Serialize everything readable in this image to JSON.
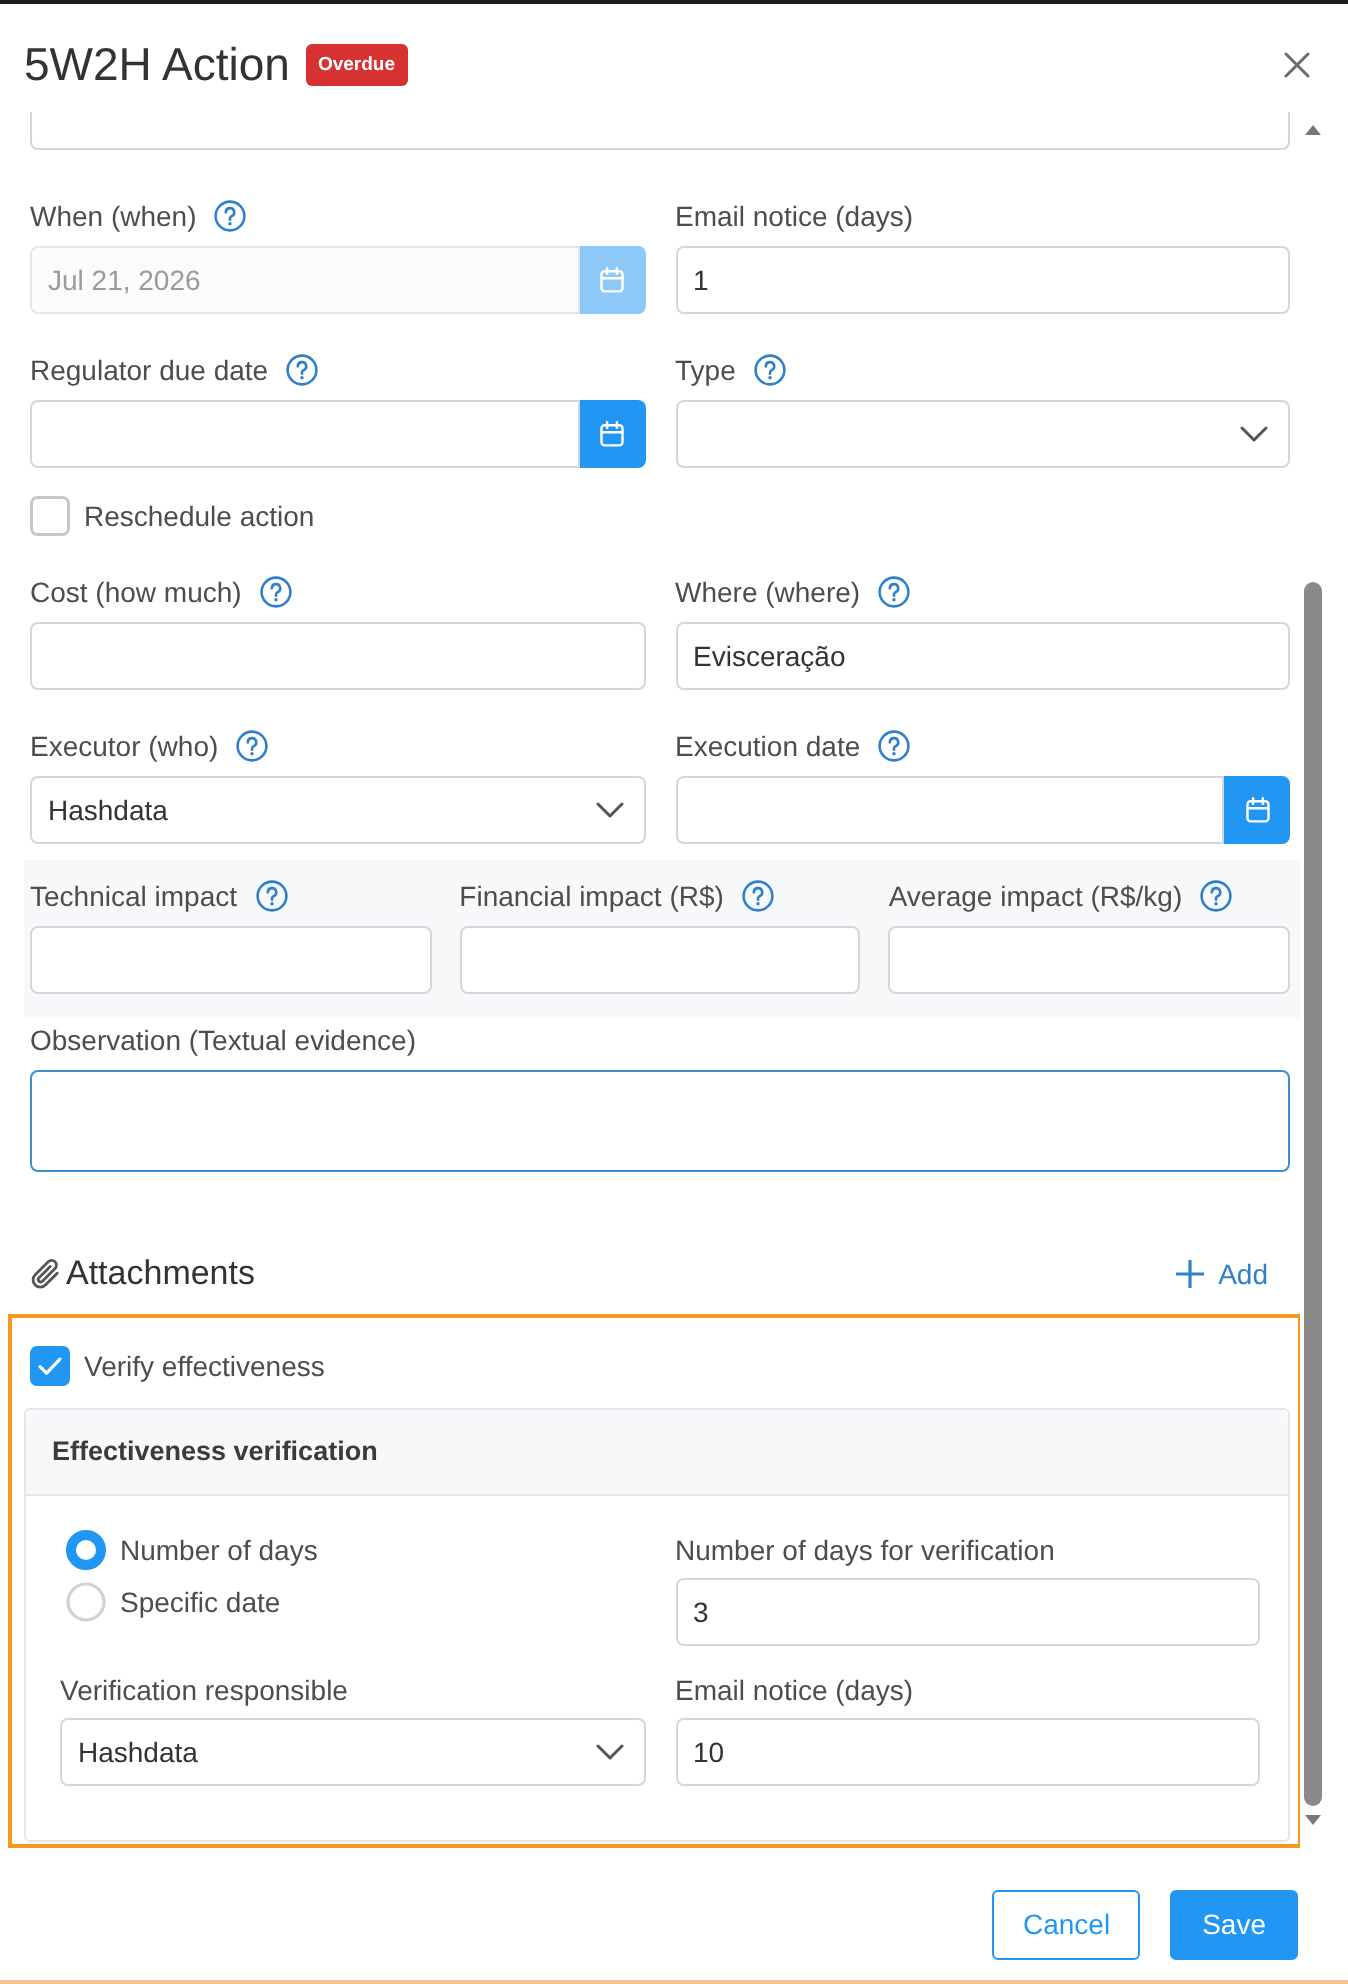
{
  "dialog": {
    "title": "5W2H Action",
    "badge": "Overdue"
  },
  "form_rows": [
    {
      "kind": "clipped"
    },
    {
      "kind": "grid",
      "fields": [
        {
          "kind": "date",
          "label": "When (when)",
          "help": true,
          "value": "Jul 21, 2026",
          "disabled": true
        },
        {
          "kind": "text",
          "label": "Email notice (days)",
          "value": "1"
        }
      ]
    },
    {
      "kind": "grid",
      "fields": [
        {
          "kind": "date",
          "label": "Regulator due date",
          "help": true,
          "disabled": false
        },
        {
          "kind": "select",
          "label": "Type",
          "help": true
        }
      ]
    },
    {
      "kind": "checkbox",
      "label": "Reschedule action",
      "checked": false
    },
    {
      "kind": "grid",
      "fields": [
        {
          "kind": "text",
          "label": "Cost (how much)",
          "help": true
        },
        {
          "kind": "text",
          "label": "Where (where)",
          "help": true,
          "value": "Evisceração"
        }
      ]
    },
    {
      "kind": "grid",
      "fields": [
        {
          "kind": "select",
          "label": "Executor (who)",
          "help": true,
          "value": "Hashdata"
        },
        {
          "kind": "date",
          "label": "Execution date",
          "help": true,
          "disabled": false
        }
      ]
    },
    {
      "kind": "shaded",
      "fields": [
        {
          "kind": "text",
          "label": "Technical impact",
          "help": true
        },
        {
          "kind": "text",
          "label": "Financial impact (R$)",
          "help": true
        },
        {
          "kind": "text",
          "label": "Average impact (R$/kg)",
          "help": true
        }
      ]
    },
    {
      "kind": "grid",
      "fields": [
        {
          "kind": "textarea",
          "label": "Observation (Textual evidence)",
          "focused": true
        }
      ]
    }
  ],
  "attachments": {
    "title": "Attachments",
    "action": "Add"
  },
  "effectiveness": {
    "label": "Verify effectiveness",
    "checked": true,
    "highlighted": true,
    "card": {
      "title": "Effectiveness verification",
      "cells": [
        {
          "kind": "radios",
          "options": [
            {
              "label": "Number of days",
              "selected": true
            },
            {
              "label": "Specific date",
              "selected": false
            }
          ]
        },
        {
          "kind": "text",
          "label": "Number of days for verification",
          "value": "3"
        },
        {
          "kind": "select",
          "label": "Verification responsible",
          "value": "Hashdata"
        },
        {
          "kind": "text",
          "label": "Email notice (days)",
          "value": "10"
        }
      ]
    }
  },
  "footer": {
    "buttons": [
      {
        "kind": "secondary",
        "label": "Cancel"
      },
      {
        "kind": "primary",
        "label": "Save"
      }
    ]
  }
}
